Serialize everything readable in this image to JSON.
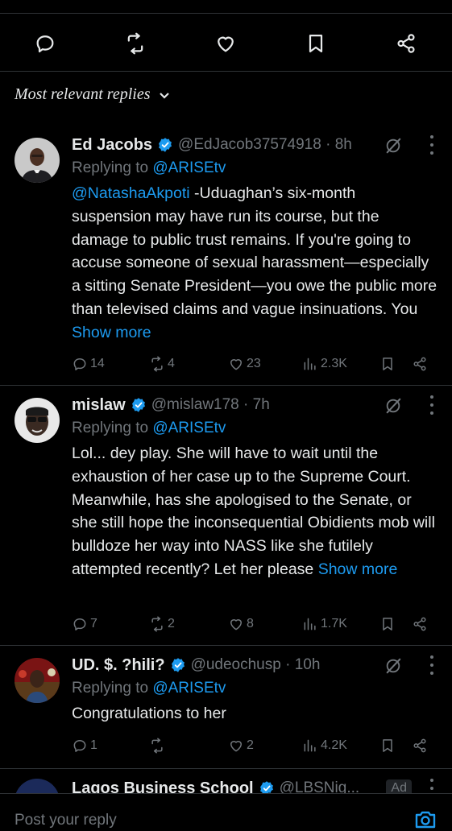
{
  "action_bar": {
    "icons": [
      "reply-icon",
      "retweet-icon",
      "like-icon",
      "bookmark-icon",
      "share-icon"
    ]
  },
  "sort": {
    "label": "Most relevant replies"
  },
  "replies": [
    {
      "name": "Ed Jacobs",
      "handle": "@EdJacob37574918 · 8h",
      "replying_prefix": "Replying to ",
      "replying_to": "@ARISEtv",
      "mention": "@NatashaAkpoti",
      "text": " -Uduaghan’s six-month suspension may have run its course, but the damage to public trust remains. If you're going to accuse someone of sexual harassment—especially a sitting Senate President—you owe the public more than televised claims and vague insinuations. You ",
      "show_more": "Show more",
      "replies": "14",
      "reposts": "4",
      "likes": "23",
      "views": "2.3K"
    },
    {
      "name": "mislaw",
      "handle": "@mislaw178 · 7h",
      "replying_prefix": "Replying to ",
      "replying_to": "@ARISEtv",
      "text": "Lol... dey play. She will have to wait until the exhaustion of her case up to the Supreme Court. Meanwhile, has she apologised to the Senate, or she still hope the inconsequential Obidients mob will bulldoze her way into NASS like she futilely attempted recently? Let her please ",
      "show_more": "Show more",
      "replies": "7",
      "reposts": "2",
      "likes": "8",
      "views": "1.7K"
    },
    {
      "name": "UD. $. ?hili?",
      "handle": "@udeochusp · 10h",
      "replying_prefix": "Replying to ",
      "replying_to": "@ARISEtv",
      "text": "Congratulations to her",
      "replies": "1",
      "reposts": "",
      "likes": "2",
      "views": "4.2K"
    }
  ],
  "ad_reply": {
    "name": "Lagos Business School",
    "handle": "@LBSNig...",
    "badge": "Ad"
  },
  "composer": {
    "placeholder": "Post your reply"
  },
  "colors": {
    "accent": "#1d9bf0",
    "muted": "#71767b",
    "text": "#e7e9ea",
    "background": "#000000"
  }
}
